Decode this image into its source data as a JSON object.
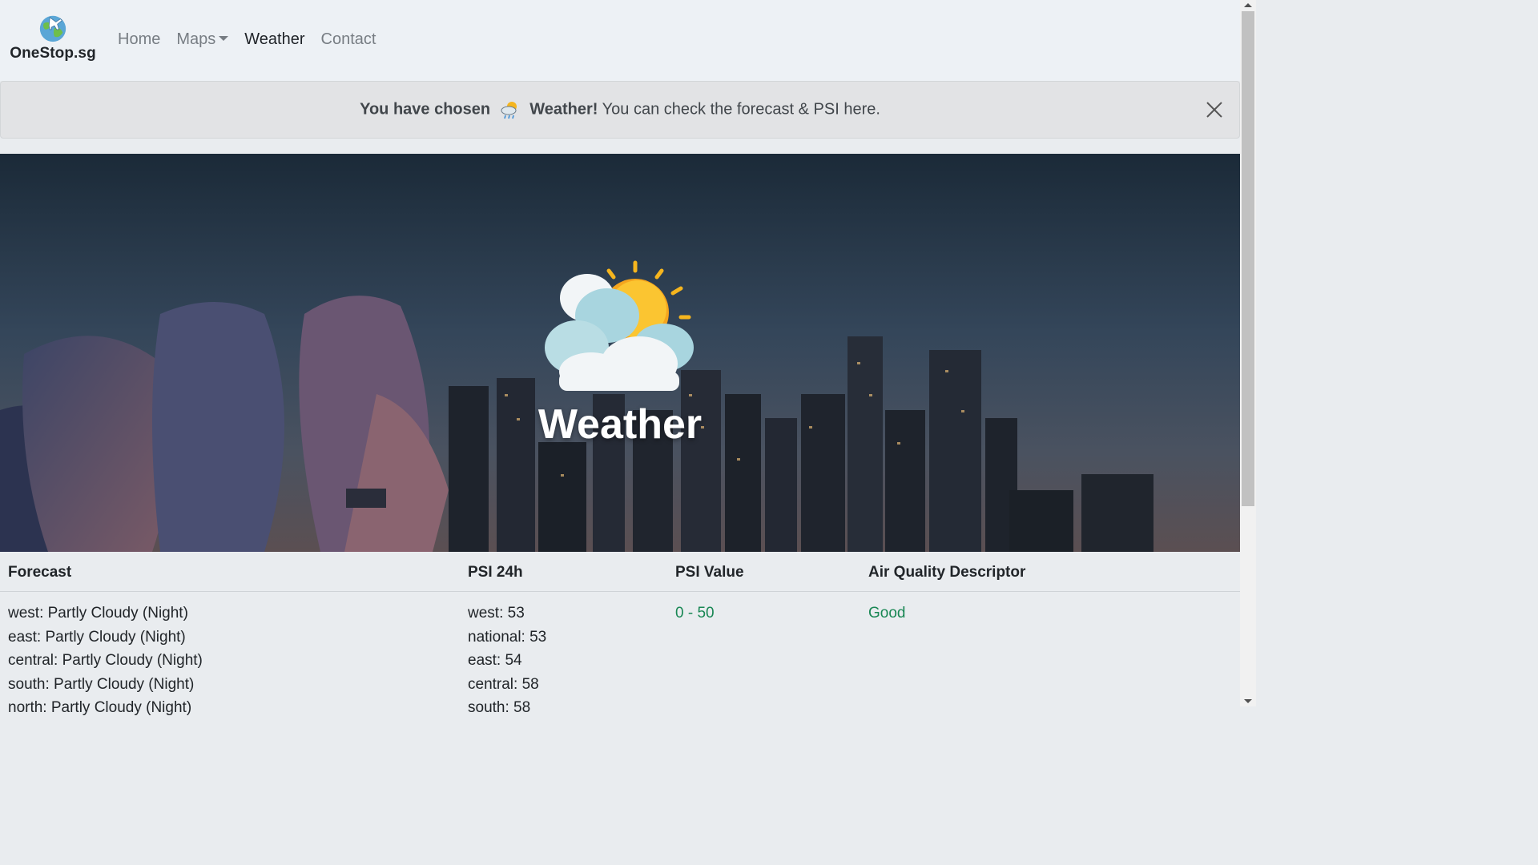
{
  "brand": {
    "name": "OneStop.sg",
    "logo_icon": "globe-plane-icon"
  },
  "nav": [
    {
      "label": "Home",
      "active": false
    },
    {
      "label": "Maps",
      "active": false,
      "dropdown": true
    },
    {
      "label": "Weather",
      "active": true
    },
    {
      "label": "Contact",
      "active": false
    }
  ],
  "alert": {
    "prefix": "You have chosen",
    "emoji_icon": "partly-cloudy-rain-icon",
    "highlight": "Weather!",
    "message": "You can check the forecast & PSI here.",
    "close_icon": "close-icon"
  },
  "hero": {
    "title": "Weather",
    "icon": "sun-behind-cloud-icon"
  },
  "table": {
    "headers": [
      "Forecast",
      "PSI 24h",
      "PSI Value",
      "Air Quality Descriptor"
    ],
    "forecast": [
      "west: Partly Cloudy (Night)",
      "east: Partly Cloudy (Night)",
      "central: Partly Cloudy (Night)",
      "south: Partly Cloudy (Night)",
      "north: Partly Cloudy (Night)"
    ],
    "psi24h": [
      "west: 53",
      "national: 53",
      "east: 54",
      "central: 58",
      "south: 58"
    ],
    "psi_value": "0 - 50",
    "air_quality": "Good",
    "good_color": "#198754"
  }
}
